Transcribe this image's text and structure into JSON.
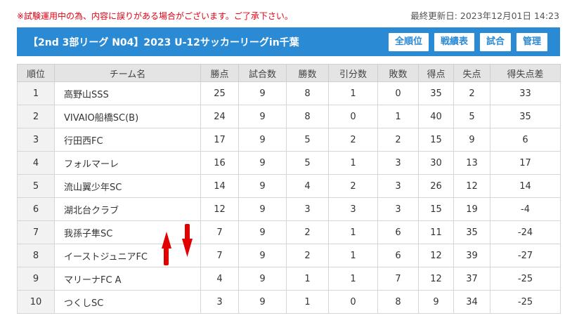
{
  "notice": "※試験運用中の為、内容に誤りがある場合がございます。ご了承下さい。",
  "last_updated": "最終更新日: 2023年12月01日 14:23",
  "league_title": "【2nd 3部リーグ N04】2023 U-12サッカーリーグin千葉",
  "buttons": {
    "all_rank": "全順位",
    "record_table": "戦績表",
    "matches": "試合",
    "admin": "管理"
  },
  "columns": [
    "順位",
    "チーム名",
    "勝点",
    "試合数",
    "勝数",
    "引分数",
    "敗数",
    "得点",
    "失点",
    "得失点差"
  ],
  "rows": [
    [
      "1",
      "高野山SSS",
      "25",
      "9",
      "8",
      "1",
      "0",
      "35",
      "2",
      "33"
    ],
    [
      "2",
      "VIVAIO船橋SC(B)",
      "24",
      "9",
      "8",
      "0",
      "1",
      "40",
      "5",
      "35"
    ],
    [
      "3",
      "行田西FC",
      "17",
      "9",
      "5",
      "2",
      "2",
      "15",
      "9",
      "6"
    ],
    [
      "4",
      "フォルマーレ",
      "16",
      "9",
      "5",
      "1",
      "3",
      "30",
      "13",
      "17"
    ],
    [
      "5",
      "流山翼少年SC",
      "14",
      "9",
      "4",
      "2",
      "3",
      "26",
      "12",
      "14"
    ],
    [
      "6",
      "湖北台クラブ",
      "12",
      "9",
      "3",
      "3",
      "3",
      "15",
      "19",
      "-4"
    ],
    [
      "7",
      "我孫子隼SC",
      "7",
      "9",
      "2",
      "1",
      "6",
      "11",
      "35",
      "-24"
    ],
    [
      "8",
      "イーストジュニアFC",
      "7",
      "9",
      "2",
      "1",
      "6",
      "12",
      "39",
      "-27"
    ],
    [
      "9",
      "マリーナFC A",
      "4",
      "9",
      "1",
      "1",
      "7",
      "12",
      "37",
      "-25"
    ],
    [
      "10",
      "つくしSC",
      "3",
      "9",
      "1",
      "0",
      "8",
      "9",
      "34",
      "-25"
    ]
  ],
  "colors": {
    "accent": "#2a8ad4",
    "notice": "#e60012",
    "annotation": "#e00000"
  },
  "annotation_icons": [
    "arrow-up-icon",
    "arrow-down-icon"
  ]
}
